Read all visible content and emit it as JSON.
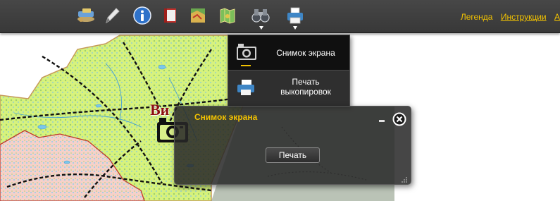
{
  "toolbar": {
    "tools": [
      {
        "name": "layers-tool-icon"
      },
      {
        "name": "pencil-tool-icon"
      },
      {
        "name": "info-tool-icon"
      },
      {
        "name": "book-tool-icon"
      },
      {
        "name": "map-tool-icon"
      },
      {
        "name": "map-fold-tool-icon"
      },
      {
        "name": "binoculars-tool-icon",
        "has_dropdown": true
      },
      {
        "name": "printer-tool-icon",
        "has_dropdown": true
      }
    ],
    "links": {
      "legend": "Легенда",
      "instructions": "Инструкции",
      "cut_off": "А"
    }
  },
  "dropdown": {
    "items": [
      {
        "label": "Снимок экрана",
        "icon": "camera-icon",
        "active": true
      },
      {
        "label_line1": "Печать",
        "label_line2": "выкопировок",
        "icon": "printer-icon"
      }
    ]
  },
  "map": {
    "city_label": "Ви"
  },
  "panel": {
    "title": "Снимок экрана",
    "print_button": "Печать"
  },
  "colors": {
    "toolbar_bg": "#3f3f3f",
    "accent": "#f2c200",
    "map_region": "#d4f07a",
    "map_region_alt": "#f5c9c3",
    "border_line": "#111111"
  }
}
